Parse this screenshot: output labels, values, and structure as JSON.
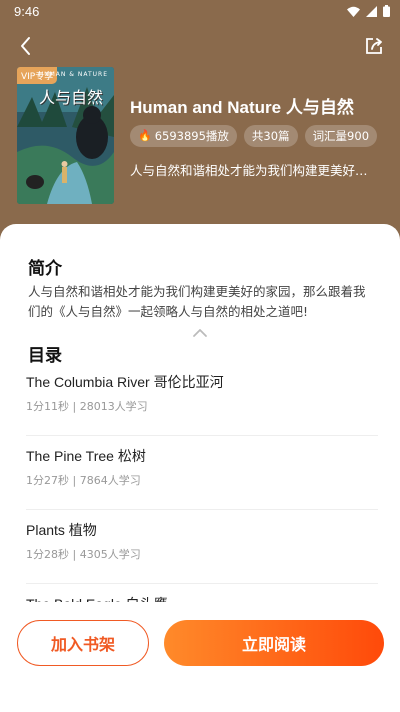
{
  "status": {
    "time": "9:46",
    "icons": [
      "wifi-icon",
      "signal-icon",
      "battery-icon"
    ]
  },
  "nav": {
    "back_icon": "chevron-left-icon",
    "share_icon": "share-icon"
  },
  "cover": {
    "vip_label": "VIP专享",
    "title_en": "HUMAN & NATURE",
    "title_cn": "人与自然"
  },
  "book": {
    "title": "Human and Nature 人与自然",
    "plays": "6593895播放",
    "chapters": "共30篇",
    "vocab": "词汇量900",
    "summary": "人与自然和谐相处才能为我们构建更美好的家园"
  },
  "intro": {
    "heading": "简介",
    "text": "人与自然和谐相处才能为我们构建更美好的家园，那么跟着我们的《人与自然》一起领略人与自然的相处之道吧!"
  },
  "toc": {
    "heading": "目录",
    "items": [
      {
        "title": "The Columbia River 哥伦比亚河",
        "meta": "1分11秒 | 28013人学习"
      },
      {
        "title": "The Pine Tree 松树",
        "meta": "1分27秒 | 7864人学习"
      },
      {
        "title": "Plants 植物",
        "meta": "1分28秒 | 4305人学习"
      },
      {
        "title": "The Bald Eagle 白头鹰",
        "meta": ""
      }
    ]
  },
  "actions": {
    "add_shelf": "加入书架",
    "read_now": "立即阅读"
  },
  "colors": {
    "header_bg": "#8a6a4c",
    "accent": "#f05a24",
    "accent_gradient_start": "#ff8a2a"
  }
}
